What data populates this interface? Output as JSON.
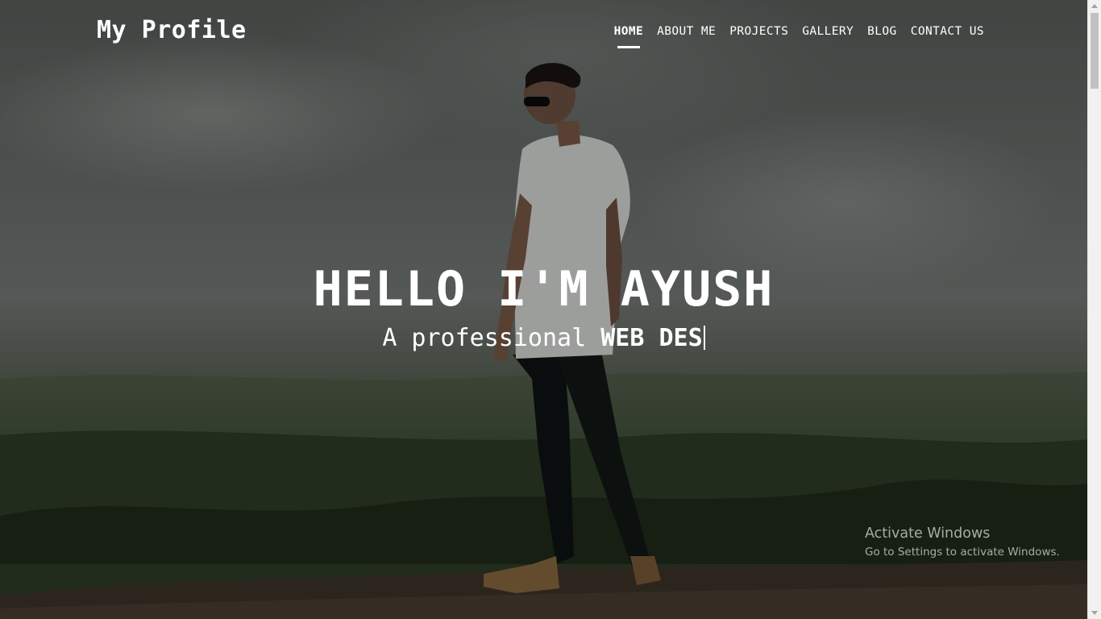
{
  "navbar": {
    "brand": "My Profile",
    "links": [
      {
        "label": "HOME",
        "active": true
      },
      {
        "label": "ABOUT ME",
        "active": false
      },
      {
        "label": "PROJECTS",
        "active": false
      },
      {
        "label": "GALLERY",
        "active": false
      },
      {
        "label": "BLOG",
        "active": false
      },
      {
        "label": "CONTACT US",
        "active": false
      }
    ]
  },
  "hero": {
    "title": "HELLO I'M AYUSH",
    "subtitle_prefix": "A professional",
    "typed_text": "WEB DES"
  },
  "watermark": {
    "title": "Activate Windows",
    "subtitle": "Go to Settings to activate Windows."
  },
  "colors": {
    "text": "#ffffff",
    "overlay": "rgba(0,0,0,0.28)",
    "scrollbar_track": "#f1f1f1",
    "scrollbar_thumb": "#c1c1c1"
  }
}
